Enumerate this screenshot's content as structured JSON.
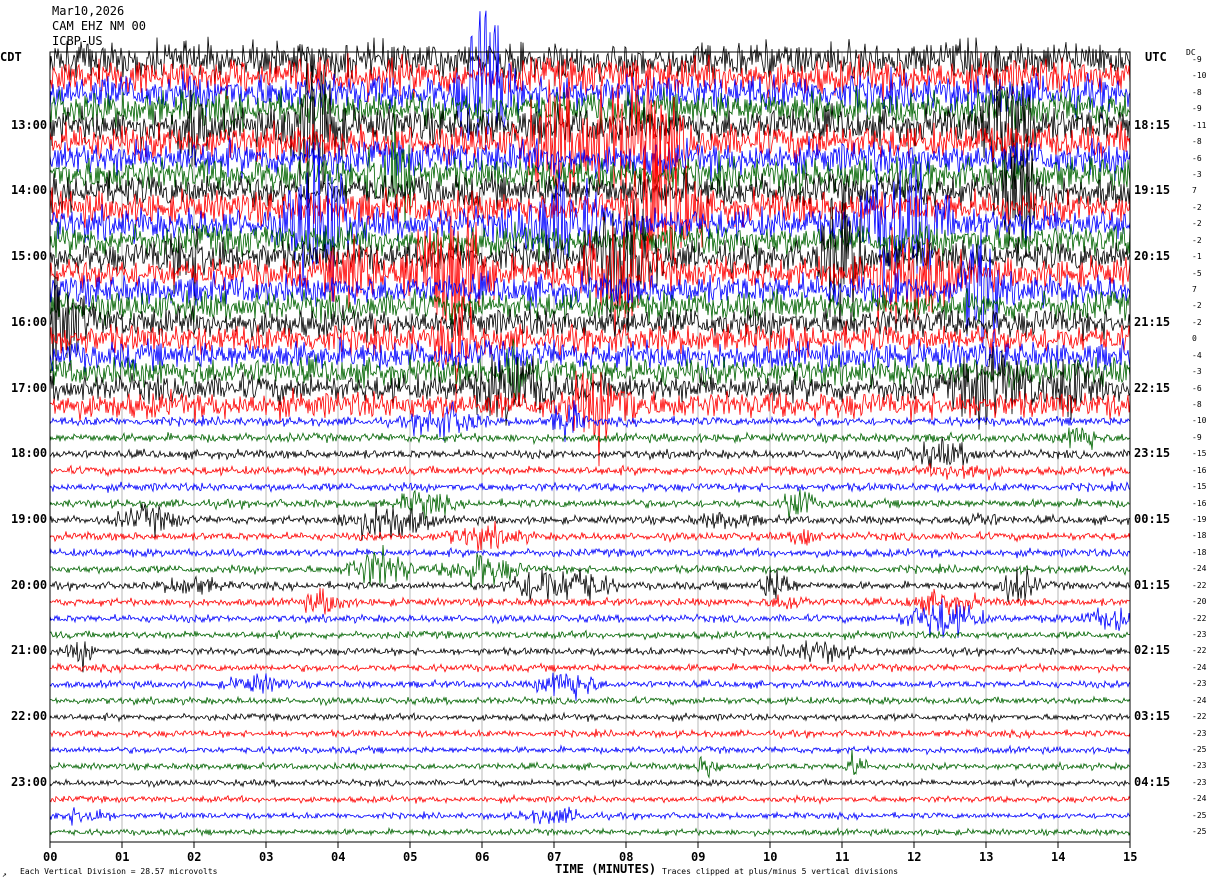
{
  "header": {
    "date": "Mar10,2026",
    "station": "CAM EHZ NM 00",
    "id": "ICBP-US"
  },
  "left_axis_label": "CDT",
  "right_axis_label": "UTC",
  "dc_label": "DC",
  "colors": [
    "#000000",
    "#ff0000",
    "#0000ff",
    "#006400"
  ],
  "chart_data": {
    "type": "line",
    "title": "",
    "xlabel": "TIME (MINUTES)",
    "x_ticks": [
      "00",
      "01",
      "02",
      "03",
      "04",
      "05",
      "06",
      "07",
      "08",
      "09",
      "10",
      "11",
      "12",
      "13",
      "14",
      "15"
    ],
    "xlim": [
      0,
      15
    ],
    "left_hour_labels": [
      "13:00",
      "14:00",
      "15:00",
      "16:00",
      "17:00",
      "18:00",
      "19:00",
      "20:00",
      "21:00",
      "22:00",
      "23:00"
    ],
    "right_hour_labels": [
      "18:15",
      "19:15",
      "20:15",
      "21:15",
      "22:15",
      "23:15",
      "00:15",
      "01:15",
      "02:15",
      "03:15",
      "04:15"
    ],
    "dc_offsets": [
      -9,
      -10,
      -8,
      -9,
      -11,
      -8,
      -6,
      -3,
      7,
      -2,
      -2,
      -2,
      -1,
      -5,
      7,
      -2,
      -2,
      0,
      -4,
      -3,
      -6,
      -8,
      -10,
      -9,
      -15,
      -16,
      -15,
      -16,
      -19,
      -18,
      -18,
      -24,
      -22,
      -20,
      -22,
      -23,
      -22,
      -24,
      -23,
      -24,
      -22,
      -23,
      -25,
      -23,
      -23,
      -24,
      -25,
      -25
    ],
    "traces_per_hour": 4,
    "trace_count": 48
  },
  "footer": {
    "scale_text": "Each Vertical Division =   28.57 microvolts",
    "clip_text": "Traces clipped at plus/minus 5 vertical divisions"
  }
}
